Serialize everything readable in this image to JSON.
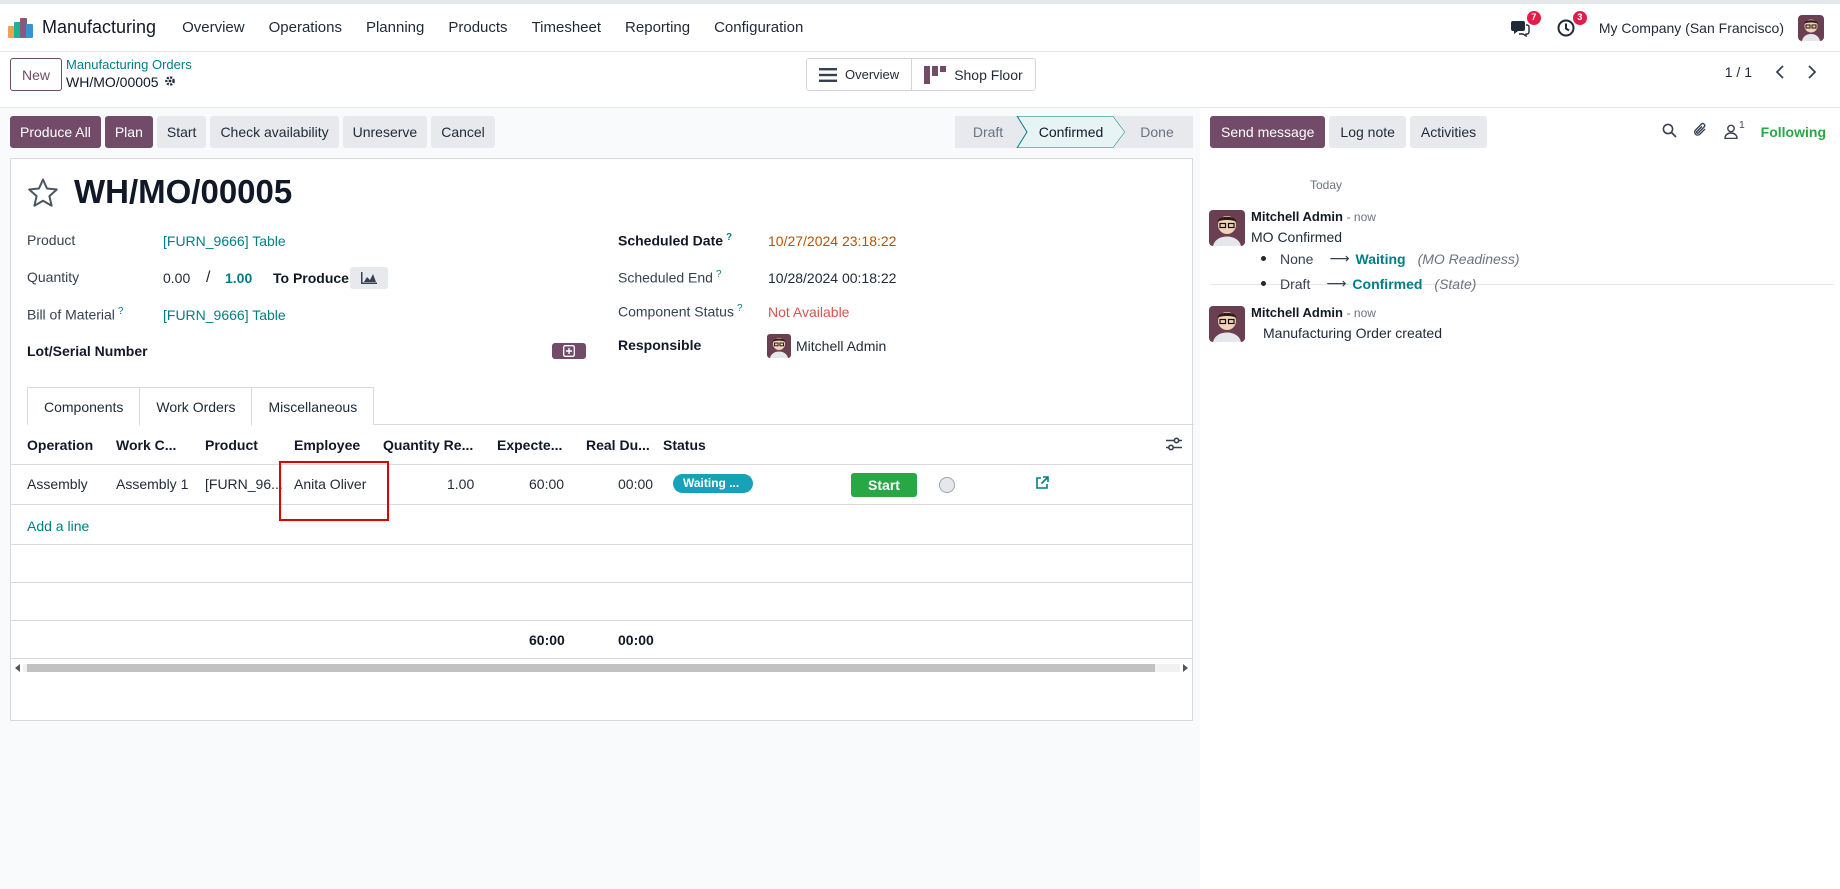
{
  "navbar": {
    "app_name": "Manufacturing",
    "menu": [
      "Overview",
      "Operations",
      "Planning",
      "Products",
      "Timesheet",
      "Reporting",
      "Configuration"
    ],
    "messages_badge": "7",
    "activities_badge": "3",
    "company": "My Company (San Francisco)"
  },
  "control_panel": {
    "new_label": "New",
    "breadcrumb_parent": "Manufacturing Orders",
    "breadcrumb_current": "WH/MO/00005",
    "view_overview": "Overview",
    "view_shop_floor": "Shop Floor",
    "pager": "1 / 1"
  },
  "statusbar": {
    "buttons": [
      "Produce All",
      "Plan",
      "Start",
      "Check availability",
      "Unreserve",
      "Cancel"
    ],
    "stages": [
      "Draft",
      "Confirmed",
      "Done"
    ],
    "active_stage": "Confirmed"
  },
  "form": {
    "title": "WH/MO/00005",
    "product_label": "Product",
    "product_value": "[FURN_9666] Table",
    "quantity_label": "Quantity",
    "quantity_produced": "0.00",
    "quantity_sep": "/",
    "quantity_total": "1.00",
    "to_produce_label": "To Produce",
    "bom_label": "Bill of Material",
    "bom_help": "?",
    "bom_value": "[FURN_9666] Table",
    "lot_label": "Lot/Serial Number",
    "scheduled_date_label": "Scheduled Date",
    "scheduled_date_help": "?",
    "scheduled_date_value": "10/27/2024 23:18:22",
    "scheduled_end_label": "Scheduled End",
    "scheduled_end_help": "?",
    "scheduled_end_value": "10/28/2024 00:18:22",
    "component_status_label": "Component Status",
    "component_status_help": "?",
    "component_status_value": "Not Available",
    "responsible_label": "Responsible",
    "responsible_value": "Mitchell Admin"
  },
  "tabs": [
    "Components",
    "Work Orders",
    "Miscellaneous"
  ],
  "active_tab": "Work Orders",
  "work_orders": {
    "columns": [
      "Operation",
      "Work C...",
      "Product",
      "Employee",
      "Quantity Re...",
      "Expecte...",
      "Real Du...",
      "Status"
    ],
    "rows": [
      {
        "operation": "Assembly",
        "work_center": "Assembly 1",
        "product": "[FURN_96...",
        "employee": "Anita Oliver",
        "quantity": "1.00",
        "expected": "60:00",
        "real": "00:00",
        "status": "Waiting ...",
        "action": "Start"
      }
    ],
    "add_line": "Add a line",
    "total_expected": "60:00",
    "total_real": "00:00"
  },
  "chatter": {
    "send_message": "Send message",
    "log_note": "Log note",
    "activities": "Activities",
    "followers_count": "1",
    "following": "Following",
    "date_separator": "Today",
    "messages": [
      {
        "author": "Mitchell Admin",
        "date": "- now",
        "body": "MO Confirmed",
        "tracking": [
          {
            "old": "None",
            "new": "Waiting",
            "field": "(MO Readiness)"
          },
          {
            "old": "Draft",
            "new": "Confirmed",
            "field": "(State)"
          }
        ]
      },
      {
        "author": "Mitchell Admin",
        "date": "- now",
        "body": "Manufacturing Order created"
      }
    ]
  },
  "colors": {
    "brand": "#714b67",
    "link": "#017e84",
    "danger": "#d9534f",
    "warning_date": "#b45309",
    "success": "#28a745",
    "info_badge": "#17a2b8",
    "highlight_box": "#e00000"
  }
}
